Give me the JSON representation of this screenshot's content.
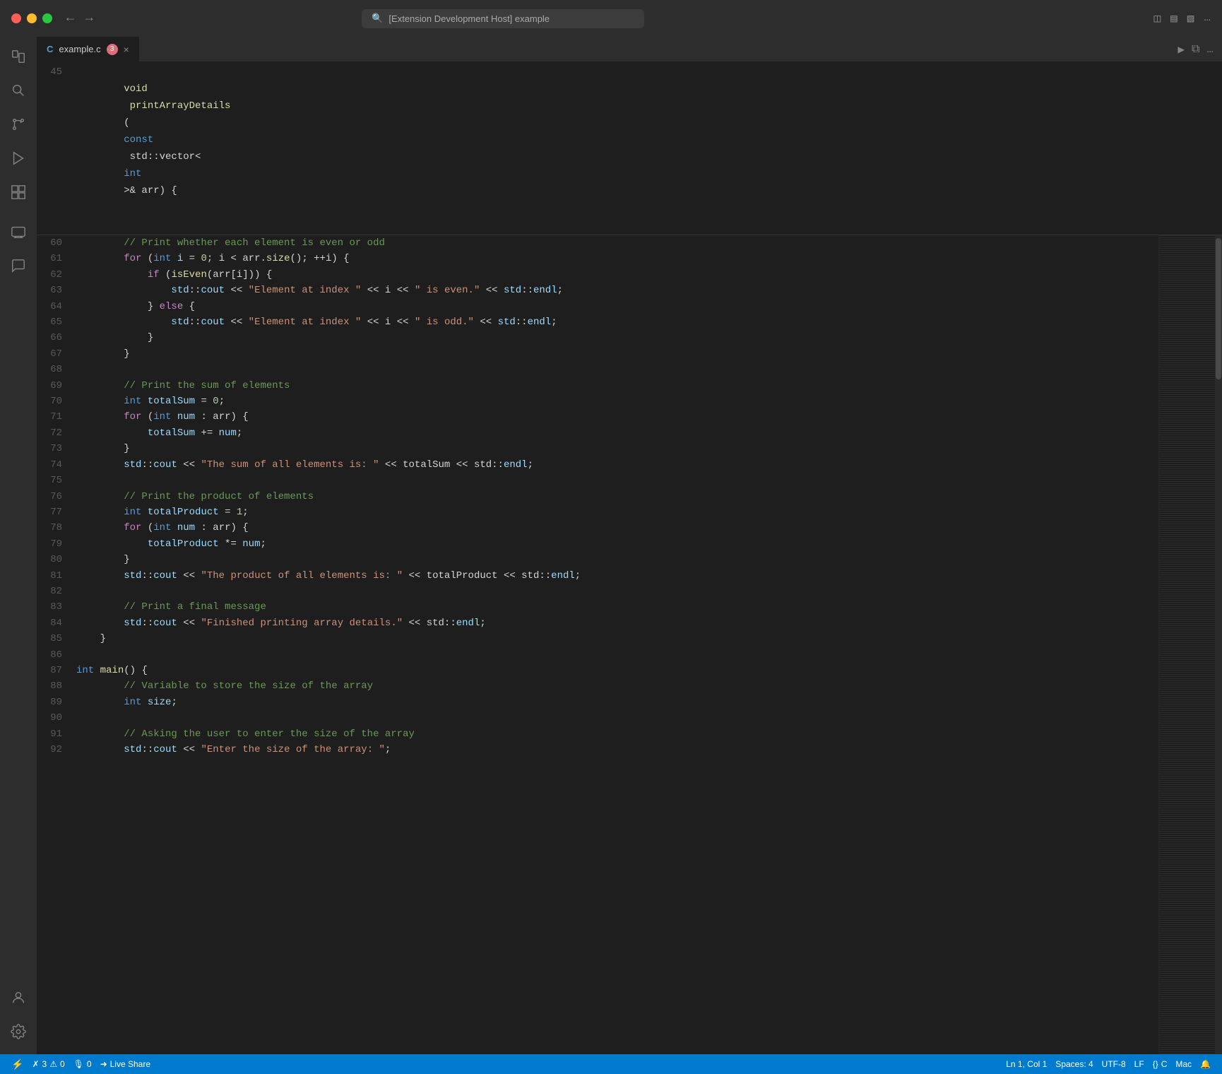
{
  "titlebar": {
    "search_placeholder": "[Extension Development Host] example",
    "back_label": "←",
    "forward_label": "→"
  },
  "tab": {
    "icon": "C",
    "filename": "example.c",
    "badge": "3",
    "close": "×"
  },
  "editor": {
    "header_line": "void printArrayDetails(const std::vector<int>& arr) {",
    "header_line_number": "45"
  },
  "status_bar": {
    "remote": "⚡",
    "errors": "3",
    "warnings": "0",
    "microphone": "0",
    "live_share": "Live Share",
    "position": "Ln 1, Col 1",
    "spaces": "Spaces: 4",
    "encoding": "UTF-8",
    "line_ending": "LF",
    "language": "C",
    "os": "Mac",
    "bell": "🔔"
  },
  "lines": [
    {
      "num": "60",
      "tokens": [
        {
          "t": "        ",
          "c": ""
        },
        {
          "t": "// Print whether each element is even or odd",
          "c": "cmt"
        }
      ]
    },
    {
      "num": "61",
      "tokens": [
        {
          "t": "        ",
          "c": ""
        },
        {
          "t": "for",
          "c": "kw"
        },
        {
          "t": " (",
          "c": ""
        },
        {
          "t": "int",
          "c": "kw"
        },
        {
          "t": " i = 0; i < arr.",
          "c": "var"
        },
        {
          "t": "size",
          "c": "fn"
        },
        {
          "t": "(); ++i) {",
          "c": ""
        }
      ]
    },
    {
      "num": "62",
      "tokens": [
        {
          "t": "            ",
          "c": ""
        },
        {
          "t": "if",
          "c": "kw"
        },
        {
          "t": " (",
          "c": ""
        },
        {
          "t": "isEven",
          "c": "fn"
        },
        {
          "t": "(arr[i])) {",
          "c": ""
        }
      ]
    },
    {
      "num": "63",
      "tokens": [
        {
          "t": "                std::",
          "c": "ns"
        },
        {
          "t": "cout",
          "c": "var"
        },
        {
          "t": " << ",
          "c": ""
        },
        {
          "t": "\"Element at index \"",
          "c": "str"
        },
        {
          "t": " << i << ",
          "c": ""
        },
        {
          "t": "\" is even.\"",
          "c": "str"
        },
        {
          "t": " << std::",
          "c": "ns"
        },
        {
          "t": "endl",
          "c": "var"
        },
        {
          "t": ";",
          "c": ""
        }
      ]
    },
    {
      "num": "64",
      "tokens": [
        {
          "t": "            } ",
          "c": ""
        },
        {
          "t": "else",
          "c": "kw"
        },
        {
          "t": " {",
          "c": ""
        }
      ]
    },
    {
      "num": "65",
      "tokens": [
        {
          "t": "                std::",
          "c": "ns"
        },
        {
          "t": "cout",
          "c": "var"
        },
        {
          "t": " << ",
          "c": ""
        },
        {
          "t": "\"Element at index \"",
          "c": "str"
        },
        {
          "t": " << i << ",
          "c": ""
        },
        {
          "t": "\" is odd.\"",
          "c": "str"
        },
        {
          "t": " << std::",
          "c": "ns"
        },
        {
          "t": "endl",
          "c": "var"
        },
        {
          "t": ";",
          "c": ""
        }
      ]
    },
    {
      "num": "66",
      "tokens": [
        {
          "t": "            }",
          "c": ""
        }
      ]
    },
    {
      "num": "67",
      "tokens": [
        {
          "t": "        }",
          "c": ""
        }
      ]
    },
    {
      "num": "68",
      "tokens": [
        {
          "t": "",
          "c": ""
        }
      ]
    },
    {
      "num": "69",
      "tokens": [
        {
          "t": "        ",
          "c": ""
        },
        {
          "t": "// Print the sum of elements",
          "c": "cmt"
        }
      ]
    },
    {
      "num": "70",
      "tokens": [
        {
          "t": "        ",
          "c": ""
        },
        {
          "t": "int",
          "c": "kw"
        },
        {
          "t": " totalSum = ",
          "c": "var"
        },
        {
          "t": "0",
          "c": "num"
        },
        {
          "t": ";",
          "c": ""
        }
      ]
    },
    {
      "num": "71",
      "tokens": [
        {
          "t": "        ",
          "c": ""
        },
        {
          "t": "for",
          "c": "kw"
        },
        {
          "t": " (",
          "c": ""
        },
        {
          "t": "int",
          "c": "kw"
        },
        {
          "t": " num : arr) {",
          "c": "var"
        }
      ]
    },
    {
      "num": "72",
      "tokens": [
        {
          "t": "            totalSum += num;",
          "c": "var"
        }
      ]
    },
    {
      "num": "73",
      "tokens": [
        {
          "t": "        }",
          "c": ""
        }
      ]
    },
    {
      "num": "74",
      "tokens": [
        {
          "t": "        std::",
          "c": "ns"
        },
        {
          "t": "cout",
          "c": "var"
        },
        {
          "t": " << ",
          "c": ""
        },
        {
          "t": "\"The sum of all elements is: \"",
          "c": "str"
        },
        {
          "t": " << totalSum << std::",
          "c": "var"
        },
        {
          "t": "endl",
          "c": "var"
        },
        {
          "t": ";",
          "c": ""
        }
      ]
    },
    {
      "num": "75",
      "tokens": [
        {
          "t": "",
          "c": ""
        }
      ]
    },
    {
      "num": "76",
      "tokens": [
        {
          "t": "        ",
          "c": ""
        },
        {
          "t": "// Print the product of elements",
          "c": "cmt"
        }
      ]
    },
    {
      "num": "77",
      "tokens": [
        {
          "t": "        ",
          "c": ""
        },
        {
          "t": "int",
          "c": "kw"
        },
        {
          "t": " totalProduct = ",
          "c": "var"
        },
        {
          "t": "1",
          "c": "num"
        },
        {
          "t": ";",
          "c": ""
        }
      ]
    },
    {
      "num": "78",
      "tokens": [
        {
          "t": "        ",
          "c": ""
        },
        {
          "t": "for",
          "c": "kw"
        },
        {
          "t": " (",
          "c": ""
        },
        {
          "t": "int",
          "c": "kw"
        },
        {
          "t": " num : arr) {",
          "c": "var"
        }
      ]
    },
    {
      "num": "79",
      "tokens": [
        {
          "t": "            totalProduct *= num;",
          "c": "var"
        }
      ]
    },
    {
      "num": "80",
      "tokens": [
        {
          "t": "        }",
          "c": ""
        }
      ]
    },
    {
      "num": "81",
      "tokens": [
        {
          "t": "        std::",
          "c": "ns"
        },
        {
          "t": "cout",
          "c": "var"
        },
        {
          "t": " << ",
          "c": ""
        },
        {
          "t": "\"The product of all elements is: \"",
          "c": "str"
        },
        {
          "t": " << totalProduct << std::",
          "c": "var"
        },
        {
          "t": "endl",
          "c": "var"
        },
        {
          "t": ";",
          "c": ""
        }
      ]
    },
    {
      "num": "82",
      "tokens": [
        {
          "t": "",
          "c": ""
        }
      ]
    },
    {
      "num": "83",
      "tokens": [
        {
          "t": "        ",
          "c": ""
        },
        {
          "t": "// Print a final message",
          "c": "cmt"
        }
      ]
    },
    {
      "num": "84",
      "tokens": [
        {
          "t": "        std::",
          "c": "ns"
        },
        {
          "t": "cout",
          "c": "var"
        },
        {
          "t": " << ",
          "c": ""
        },
        {
          "t": "\"Finished printing array details.\"",
          "c": "str"
        },
        {
          "t": " << std::",
          "c": "ns"
        },
        {
          "t": "endl",
          "c": "var"
        },
        {
          "t": ";",
          "c": ""
        }
      ]
    },
    {
      "num": "85",
      "tokens": [
        {
          "t": "    }",
          "c": ""
        }
      ]
    },
    {
      "num": "86",
      "tokens": [
        {
          "t": "",
          "c": ""
        }
      ]
    },
    {
      "num": "87",
      "tokens": [
        {
          "t": "",
          "c": ""
        },
        {
          "t": "int",
          "c": "kw"
        },
        {
          "t": " ",
          "c": ""
        },
        {
          "t": "main",
          "c": "fn"
        },
        {
          "t": "() {",
          "c": ""
        }
      ]
    },
    {
      "num": "88",
      "tokens": [
        {
          "t": "        ",
          "c": ""
        },
        {
          "t": "// Variable to store the size of the array",
          "c": "cmt"
        }
      ]
    },
    {
      "num": "89",
      "tokens": [
        {
          "t": "        ",
          "c": ""
        },
        {
          "t": "int",
          "c": "kw"
        },
        {
          "t": " size;",
          "c": "var"
        }
      ]
    },
    {
      "num": "90",
      "tokens": [
        {
          "t": "",
          "c": ""
        }
      ]
    },
    {
      "num": "91",
      "tokens": [
        {
          "t": "        ",
          "c": ""
        },
        {
          "t": "// Asking the user to enter the size of the array",
          "c": "cmt"
        }
      ]
    },
    {
      "num": "92",
      "tokens": [
        {
          "t": "        std::",
          "c": "ns"
        },
        {
          "t": "cout",
          "c": "var"
        },
        {
          "t": " << ",
          "c": ""
        },
        {
          "t": "\"Enter the size of the array: \"",
          "c": "str"
        },
        {
          "t": ";",
          "c": ""
        }
      ]
    }
  ],
  "sidebar": {
    "icons": [
      {
        "name": "files-icon",
        "unicode": "⎘"
      },
      {
        "name": "search-icon",
        "unicode": "⌕"
      },
      {
        "name": "source-control-icon",
        "unicode": "⑂"
      },
      {
        "name": "run-debug-icon",
        "unicode": "▷"
      },
      {
        "name": "extensions-icon",
        "unicode": "⊞"
      },
      {
        "name": "remote-explorer-icon",
        "unicode": "🖥"
      },
      {
        "name": "chat-icon",
        "unicode": "💬"
      }
    ],
    "bottom_icons": [
      {
        "name": "account-icon",
        "unicode": "⊙"
      },
      {
        "name": "settings-icon",
        "unicode": "⚙"
      }
    ]
  }
}
